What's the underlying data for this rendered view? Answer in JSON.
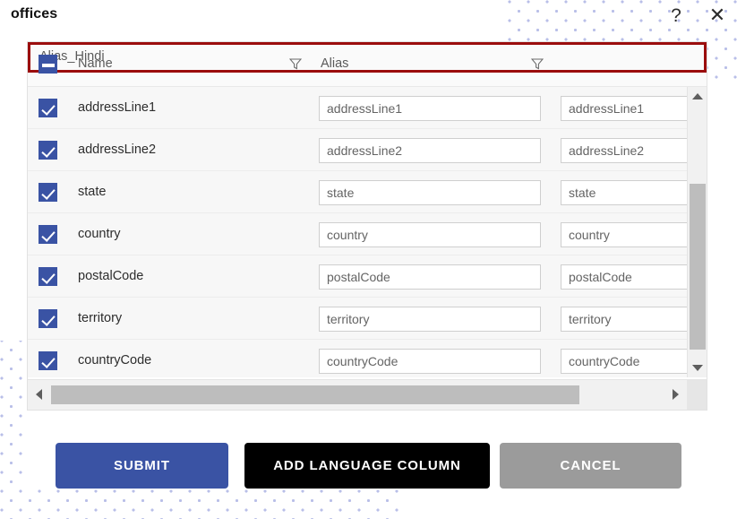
{
  "window": {
    "title": "offices",
    "help_icon": "question-mark-icon",
    "help_label": "?",
    "close_icon": "close-icon",
    "close_label": "✕"
  },
  "colors": {
    "accent_blue": "#3a53a4",
    "highlight_border": "#9b0d0d",
    "button_black": "#000000",
    "button_gray": "#9b9b9b",
    "dot_pattern": "#b9bfe8",
    "row_background": "#f7f7f7"
  },
  "table": {
    "header": {
      "select_all_checkbox_state": "indeterminate",
      "columns": [
        {
          "key": "name",
          "label": "Name",
          "filterable": false,
          "highlighted": false
        },
        {
          "key": "alias",
          "label": "Alias",
          "filterable": true,
          "highlighted": false
        },
        {
          "key": "alias_hindi",
          "label": "Alias_Hindi",
          "filterable": true,
          "highlighted": true
        }
      ],
      "filter_icon": "filter-funnel-icon"
    },
    "rows": [
      {
        "checked": true,
        "name": "addressLine1",
        "alias": "addressLine1",
        "alias_hindi": "addressLine1"
      },
      {
        "checked": true,
        "name": "addressLine2",
        "alias": "addressLine2",
        "alias_hindi": "addressLine2"
      },
      {
        "checked": true,
        "name": "state",
        "alias": "state",
        "alias_hindi": "state"
      },
      {
        "checked": true,
        "name": "country",
        "alias": "country",
        "alias_hindi": "country"
      },
      {
        "checked": true,
        "name": "postalCode",
        "alias": "postalCode",
        "alias_hindi": "postalCode"
      },
      {
        "checked": true,
        "name": "territory",
        "alias": "territory",
        "alias_hindi": "territory"
      },
      {
        "checked": true,
        "name": "countryCode",
        "alias": "countryCode",
        "alias_hindi": "countryCode"
      }
    ],
    "scrollbars": {
      "vertical": {
        "visible": true,
        "up_icon": "triangle-up-icon",
        "down_icon": "triangle-down-icon"
      },
      "horizontal": {
        "visible": true,
        "left_icon": "triangle-left-icon",
        "right_icon": "triangle-right-icon"
      }
    }
  },
  "footer": {
    "submit_label": "SUBMIT",
    "add_language_column_label": "ADD LANGUAGE COLUMN",
    "cancel_label": "CANCEL"
  }
}
